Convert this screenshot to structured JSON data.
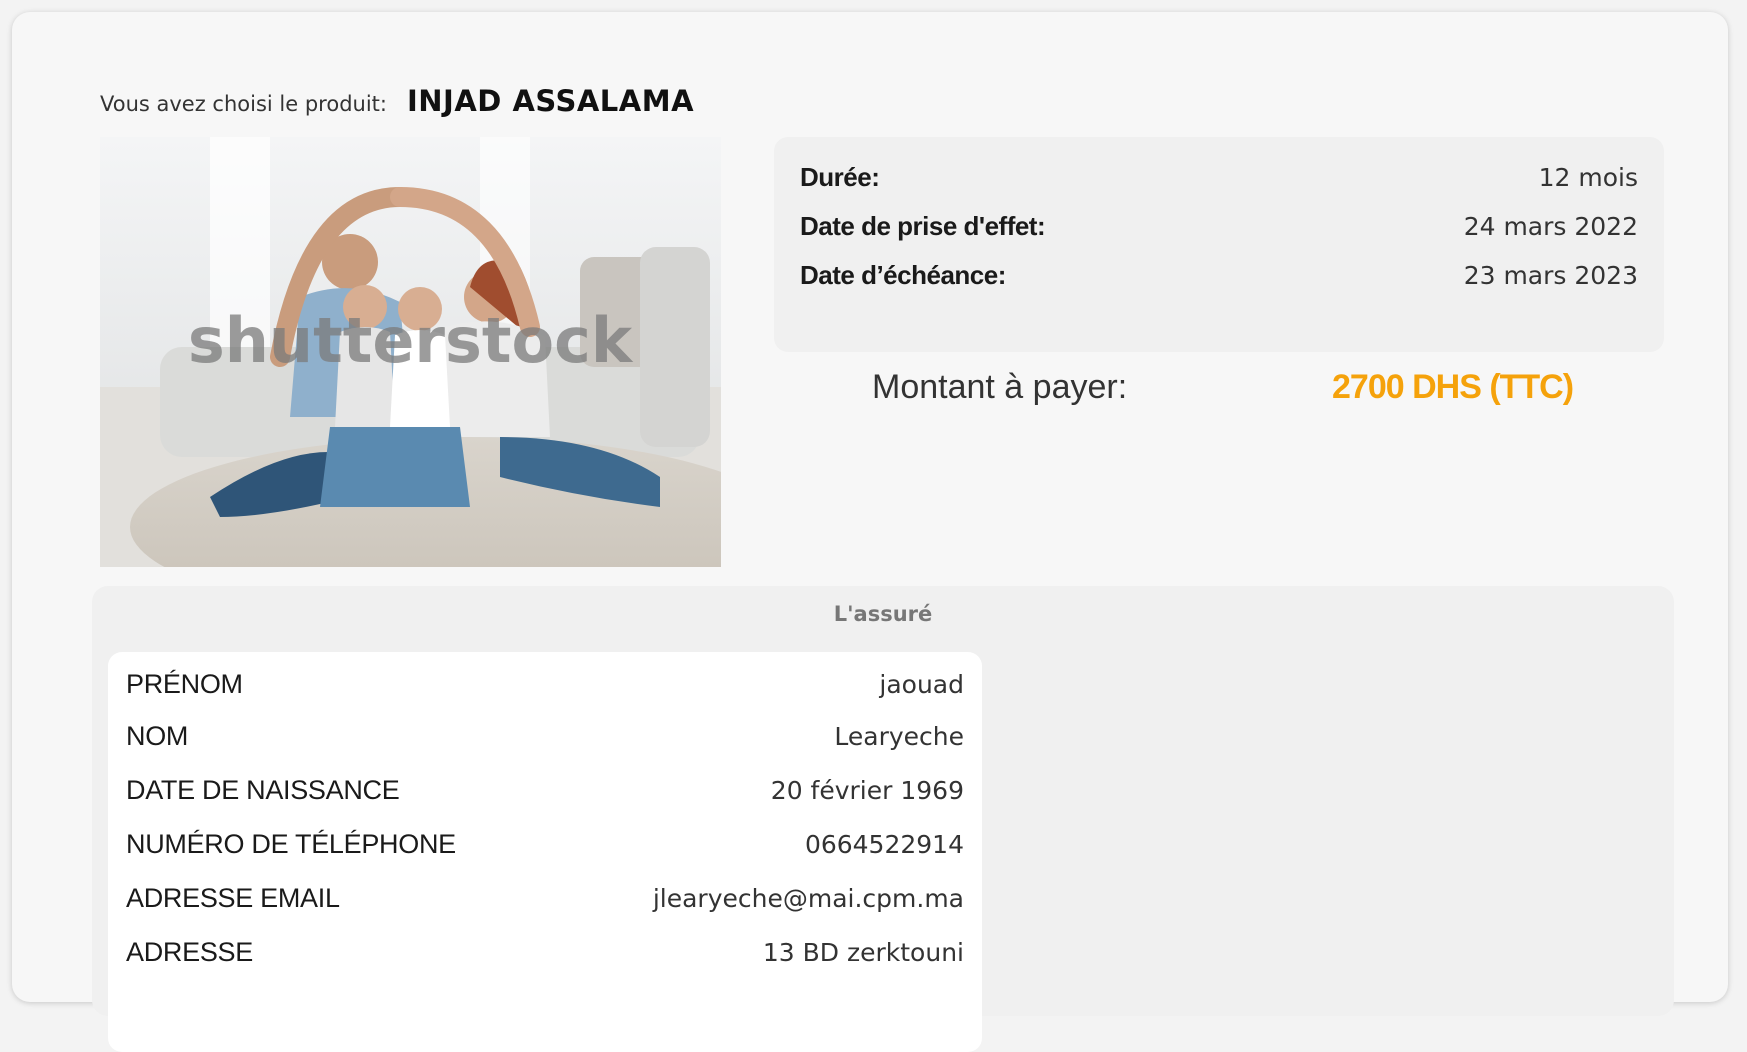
{
  "product": {
    "prefix": "Vous avez choisi le produit:",
    "name": "INJAD ASSALAMA"
  },
  "image": {
    "watermark": "shutterstock"
  },
  "details": [
    {
      "label": "Durée:",
      "value": "12 mois"
    },
    {
      "label": "Date de prise d'effet:",
      "value": "24 mars 2022"
    },
    {
      "label": "Date d’échéance:",
      "value": "23 mars 2023"
    }
  ],
  "amount": {
    "label": "Montant à payer:",
    "value": "2700 DHS (TTC)",
    "color": "#f5a20b"
  },
  "insured": {
    "title": "L'assuré",
    "fields": [
      {
        "label": "PRÉNOM",
        "value": "jaouad"
      },
      {
        "label": "NOM",
        "value": "Learyeche"
      },
      {
        "label": "DATE DE NAISSANCE",
        "value": "20 février 1969"
      },
      {
        "label": "NUMÉRO DE TÉLÉPHONE",
        "value": "0664522914"
      },
      {
        "label": "ADRESSE EMAIL",
        "value": "jlearyeche@mai.cpm.ma"
      },
      {
        "label": "ADRESSE",
        "value": "13 BD zerktouni"
      }
    ]
  }
}
